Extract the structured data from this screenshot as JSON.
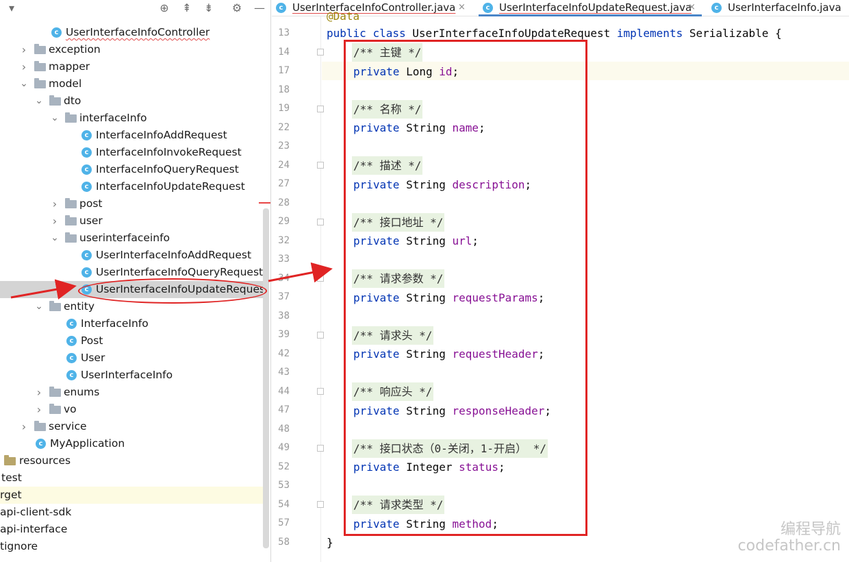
{
  "project": {
    "toolbar": [
      "chevron-down-icon",
      "locate-icon",
      "expand-all-icon",
      "collapse-all-icon",
      "gear-icon",
      "minimize-icon"
    ],
    "tree": [
      {
        "label": "UserInterfaceInfoController",
        "kind": "class",
        "squiggle": true
      },
      {
        "label": "exception",
        "kind": "folder",
        "expanded": false
      },
      {
        "label": "mapper",
        "kind": "folder",
        "expanded": false
      },
      {
        "label": "model",
        "kind": "folder",
        "expanded": true
      },
      {
        "label": "dto",
        "kind": "folder",
        "expanded": true
      },
      {
        "label": "interfaceInfo",
        "kind": "folder",
        "expanded": true
      },
      {
        "label": "InterfaceInfoAddRequest",
        "kind": "class"
      },
      {
        "label": "InterfaceInfoInvokeRequest",
        "kind": "class"
      },
      {
        "label": "InterfaceInfoQueryRequest",
        "kind": "class"
      },
      {
        "label": "InterfaceInfoUpdateRequest",
        "kind": "class"
      },
      {
        "label": "post",
        "kind": "folder",
        "expanded": false
      },
      {
        "label": "user",
        "kind": "folder",
        "expanded": false
      },
      {
        "label": "userinterfaceinfo",
        "kind": "folder",
        "expanded": true
      },
      {
        "label": "UserInterfaceInfoAddRequest",
        "kind": "class"
      },
      {
        "label": "UserInterfaceInfoQueryRequest",
        "kind": "class"
      },
      {
        "label": "UserInterfaceInfoUpdateRequest",
        "kind": "class",
        "selected": true
      },
      {
        "label": "entity",
        "kind": "folder",
        "expanded": true
      },
      {
        "label": "InterfaceInfo",
        "kind": "class"
      },
      {
        "label": "Post",
        "kind": "class"
      },
      {
        "label": "User",
        "kind": "class"
      },
      {
        "label": "UserInterfaceInfo",
        "kind": "class"
      },
      {
        "label": "enums",
        "kind": "folder",
        "expanded": false
      },
      {
        "label": "vo",
        "kind": "folder",
        "expanded": false
      },
      {
        "label": "service",
        "kind": "folder",
        "expanded": false
      },
      {
        "label": "MyApplication",
        "kind": "app"
      },
      {
        "label": "resources",
        "kind": "resfolder"
      },
      {
        "label": "test",
        "kind": "plain"
      },
      {
        "label": "rget",
        "kind": "plain",
        "highlight": true
      },
      {
        "label": "api-client-sdk",
        "kind": "plain"
      },
      {
        "label": "api-interface",
        "kind": "plain"
      },
      {
        "label": "tignore",
        "kind": "plain"
      }
    ]
  },
  "tabs": [
    {
      "label": "UserInterfaceInfoController.java",
      "active": false
    },
    {
      "label": "UserInterfaceInfoUpdateRequest.java",
      "active": true
    },
    {
      "label": "UserInterfaceInfo.java",
      "active": false
    }
  ],
  "tab_close_glyph": "×",
  "editor": {
    "partial_annotation": "@Data",
    "class_decl": {
      "kw1": "public",
      "kw2": "class",
      "name": "UserInterfaceInfoUpdateRequest",
      "kw3": "implements",
      "iface": "Serializable {"
    },
    "line_numbers": [
      "13",
      "14",
      "17",
      "18",
      "19",
      "22",
      "23",
      "24",
      "27",
      "28",
      "29",
      "32",
      "33",
      "34",
      "37",
      "38",
      "39",
      "42",
      "43",
      "44",
      "47",
      "48",
      "49",
      "52",
      "53",
      "54",
      "57",
      "58"
    ],
    "fields": [
      {
        "comment": "/** 主键 */",
        "type": "Long",
        "name": "id"
      },
      {
        "comment": "/** 名称 */",
        "type": "String",
        "name": "name"
      },
      {
        "comment": "/** 描述 */",
        "type": "String",
        "name": "description"
      },
      {
        "comment": "/** 接口地址 */",
        "type": "String",
        "name": "url"
      },
      {
        "comment": "/** 请求参数 */",
        "type": "String",
        "name": "requestParams"
      },
      {
        "comment": "/** 请求头 */",
        "type": "String",
        "name": "requestHeader"
      },
      {
        "comment": "/** 响应头 */",
        "type": "String",
        "name": "responseHeader"
      },
      {
        "comment": "/** 接口状态（0-关闭，1-开启） */",
        "type": "Integer",
        "name": "status"
      },
      {
        "comment": "/** 请求类型 */",
        "type": "String",
        "name": "method"
      }
    ],
    "private_kw": "private",
    "closing_brace": "}"
  },
  "watermark": {
    "line1": "编程导航",
    "line2": "codefather.cn"
  },
  "colors": {
    "accent": "#4a86c8",
    "annotation": "#e02424",
    "keyword": "#0033b3",
    "field": "#871094"
  }
}
